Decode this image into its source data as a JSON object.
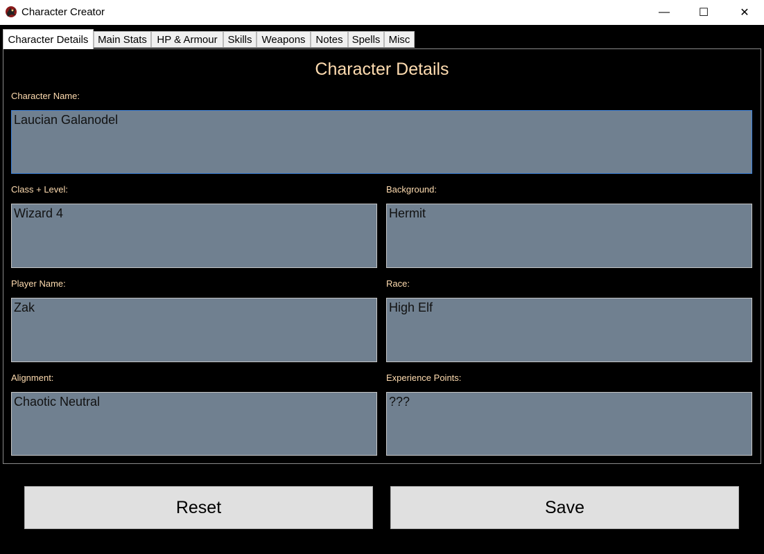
{
  "window": {
    "title": "Character Creator",
    "minimize_glyph": "—",
    "maximize_glyph": "☐",
    "close_glyph": "✕"
  },
  "tabs": [
    {
      "label": "Character Details",
      "active": true
    },
    {
      "label": "Main Stats",
      "active": false
    },
    {
      "label": "HP & Armour",
      "active": false
    },
    {
      "label": "Skills",
      "active": false
    },
    {
      "label": "Weapons",
      "active": false
    },
    {
      "label": "Notes",
      "active": false
    },
    {
      "label": "Spells",
      "active": false
    },
    {
      "label": "Misc",
      "active": false
    }
  ],
  "panel": {
    "title": "Character Details"
  },
  "fields": {
    "character_name": {
      "label": "Character Name:",
      "value": "Laucian Galanodel"
    },
    "class_level": {
      "label": "Class + Level:",
      "value": "Wizard 4"
    },
    "background": {
      "label": "Background:",
      "value": "Hermit"
    },
    "player_name": {
      "label": "Player Name:",
      "value": "Zak"
    },
    "race": {
      "label": "Race:",
      "value": "High Elf"
    },
    "alignment": {
      "label": "Alignment:",
      "value": "Chaotic Neutral"
    },
    "experience_points": {
      "label": "Experience Points:",
      "value": "???"
    }
  },
  "buttons": {
    "reset": "Reset",
    "save": "Save"
  },
  "colors": {
    "background": "#000000",
    "label": "#ffdcb0",
    "field": "#708090",
    "button": "#e0e0e0"
  }
}
